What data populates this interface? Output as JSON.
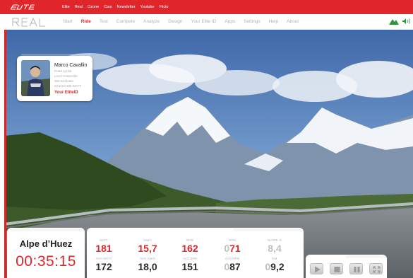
{
  "top_bar": {
    "links": [
      "Elite",
      "Real",
      "Ozone",
      "Ciao",
      "Newsletter",
      "Youtube",
      "Flickr"
    ]
  },
  "nav": {
    "items": [
      "Start",
      "Ride",
      "Test",
      "Compete",
      "Analyze",
      "Design",
      "Your Elite ID",
      "Apps",
      "Settings",
      "Help",
      "About"
    ],
    "active": "Ride"
  },
  "profile": {
    "name": "Marco Cavallin",
    "lines": [
      "Road cyclist",
      "Level Contender",
      "300 workouts",
      "Ozoned 305 WATT"
    ],
    "link_label": "Your EliteID"
  },
  "route": {
    "name": "Alpe d’Huez",
    "elapsed_time": "00:35:15"
  },
  "stats": [
    {
      "label": "WATT",
      "value": "181",
      "tone": "red"
    },
    {
      "label": "KM/H",
      "value": "15,7",
      "tone": "red"
    },
    {
      "label": "BPM",
      "value": "162",
      "tone": "red"
    },
    {
      "label": "RPM",
      "value_prefix": "0",
      "value": "71",
      "tone": "red"
    },
    {
      "label": "SLOPE %",
      "value": "8,4",
      "tone": "grey"
    },
    {
      "label": "AVG WATT",
      "value": "172",
      "tone": "dark"
    },
    {
      "label": "AVG KM/H",
      "value": "18,0",
      "tone": "dark"
    },
    {
      "label": "AVG BPM",
      "value": "151",
      "tone": "dark"
    },
    {
      "label": "AVG RPM",
      "value_prefix": "0",
      "value": "87",
      "tone": "dark"
    },
    {
      "label": "KM",
      "value_prefix": "0",
      "value": "9,2",
      "tone": "dark"
    }
  ],
  "controls": {
    "icons": [
      "play-icon",
      "stop-icon",
      "pause-icon",
      "fullscreen-icon"
    ]
  },
  "colors": {
    "brand_red": "#e0262b",
    "nav_text": "#b0b0b0",
    "brand_green": "#2c9a3c"
  }
}
